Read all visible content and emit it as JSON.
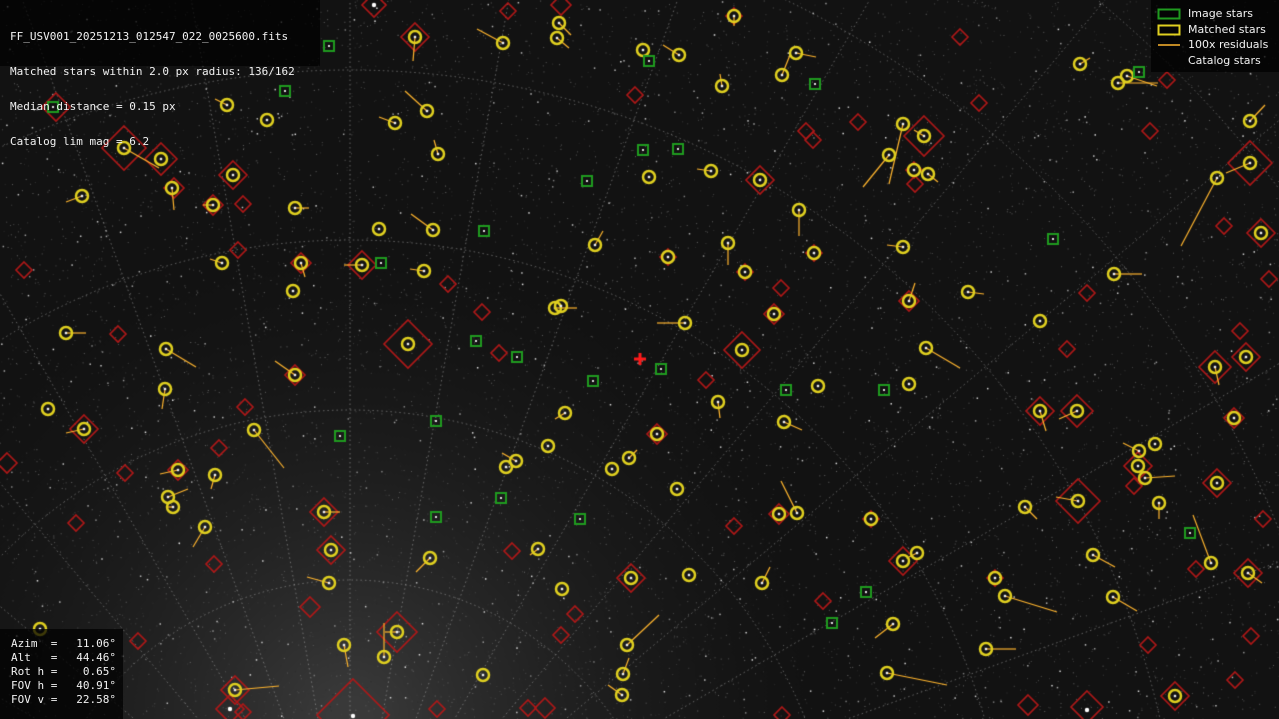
{
  "colors": {
    "background": "#121212",
    "grid": "#a0a0a0",
    "image_star": "#1f9a1f",
    "matched_star": "#e0d020",
    "residual": "#ffb52e",
    "catalog_star": "#b01818",
    "center_marker": "#ff1a1a",
    "text": "#f2f2f2"
  },
  "info": {
    "filename": "FF_USV001_20251213_012547_022_0025600.fits",
    "matched": "Matched stars within 2.0 px radius: 136/162",
    "median": "Median distance = 0.15 px",
    "catalog_lim": "Catalog lim mag = 6.2"
  },
  "legend": {
    "image_stars": "Image stars",
    "matched_stars": "Matched stars",
    "residuals": "100x residuals",
    "catalog_stars": "Catalog stars"
  },
  "pointing": {
    "azim_label": "Azim",
    "azim_value": "11.06°",
    "alt_label": "Alt",
    "alt_value": "44.46°",
    "rot_label": "Rot h",
    "rot_value": "0.65°",
    "fovh_label": "FOV h",
    "fovh_value": "40.91°",
    "fovv_label": "FOV v",
    "fovv_value": "22.58°"
  },
  "icons": {
    "center": "red-cross-icon",
    "image_star": "green-square-icon",
    "matched_star": "yellow-circle-icon",
    "catalog_star": "red-diamond-icon"
  }
}
